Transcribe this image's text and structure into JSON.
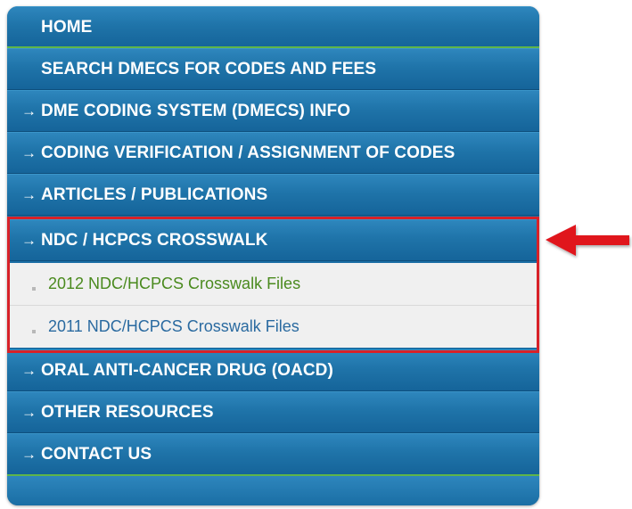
{
  "menu": {
    "items": [
      {
        "label": "HOME",
        "arrow": false
      },
      {
        "label": "SEARCH DMECS FOR CODES AND FEES",
        "arrow": false
      },
      {
        "label": "DME CODING SYSTEM (DMECS) INFO",
        "arrow": true
      },
      {
        "label": "CODING VERIFICATION / ASSIGNMENT OF CODES",
        "arrow": true
      },
      {
        "label": "ARTICLES / PUBLICATIONS",
        "arrow": true
      },
      {
        "label": "NDC / HCPCS CROSSWALK",
        "arrow": true
      },
      {
        "label": "ORAL ANTI-CANCER DRUG (OACD)",
        "arrow": true
      },
      {
        "label": "OTHER RESOURCES",
        "arrow": true
      },
      {
        "label": "CONTACT US",
        "arrow": true
      }
    ],
    "arrow_glyph": "→",
    "subitems": [
      {
        "label": "2012 NDC/HCPCS Crosswalk Files"
      },
      {
        "label": "2011 NDC/HCPCS Crosswalk Files"
      }
    ]
  },
  "colors": {
    "menu_blue": "#1f74a9",
    "accent_green": "#5fb54a",
    "highlight_red": "#d82128",
    "sub_link_green": "#4a8a1e",
    "sub_link_blue": "#2a6aa0"
  },
  "icons": {
    "item_arrow": "arrow-right-icon",
    "callout": "red-left-arrow-icon"
  }
}
